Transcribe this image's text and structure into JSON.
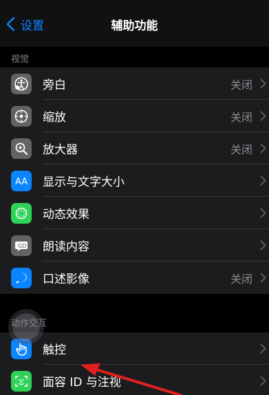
{
  "nav": {
    "back_label": "设置",
    "title": "辅助功能"
  },
  "sections": {
    "vision": {
      "header": "视觉",
      "rows": [
        {
          "label": "旁白",
          "value": "关闭",
          "icon": "voiceover-icon",
          "color": "#636366"
        },
        {
          "label": "缩放",
          "value": "关闭",
          "icon": "zoom-icon",
          "color": "#636366"
        },
        {
          "label": "放大器",
          "value": "关闭",
          "icon": "magnifier-icon",
          "color": "#636366"
        },
        {
          "label": "显示与文字大小",
          "value": "",
          "icon": "text-size-icon",
          "color": "#0a84ff"
        },
        {
          "label": "动态效果",
          "value": "",
          "icon": "motion-icon",
          "color": "#30d158"
        },
        {
          "label": "朗读内容",
          "value": "",
          "icon": "spoken-content-icon",
          "color": "#636366"
        },
        {
          "label": "口述影像",
          "value": "关闭",
          "icon": "audio-description-icon",
          "color": "#0a84ff"
        }
      ]
    },
    "interaction": {
      "header": "动作交互",
      "rows": [
        {
          "label": "触控",
          "value": "",
          "icon": "touch-icon",
          "color": "#0a84ff"
        },
        {
          "label": "面容 ID 与注视",
          "value": "",
          "icon": "face-id-icon",
          "color": "#30d158"
        }
      ]
    }
  },
  "colors": {
    "accent": "#0a84ff",
    "annotation_arrow": "#e02020"
  }
}
